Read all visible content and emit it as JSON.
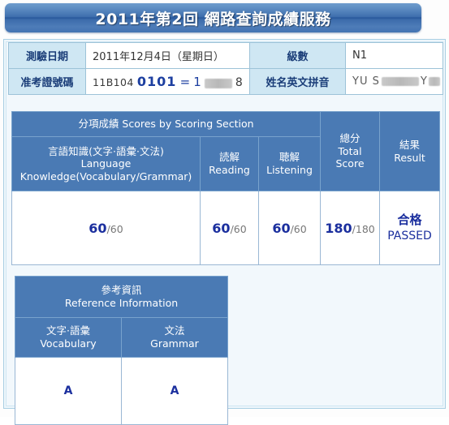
{
  "header": {
    "title": "2011年第2回 網路查詢成績服務"
  },
  "info": {
    "rows": [
      {
        "label": "測驗日期",
        "value": "2011年12月4日（星期日）",
        "label2": "級數",
        "value2": "N1"
      },
      {
        "label": "准考證號碼",
        "code_prefix": "11B104",
        "code_mid": "0101",
        "code_eq": "=",
        "code_after_eq": "1",
        "code_tail": "8",
        "label2": "姓名英文拼音",
        "name_prefix": "YU S",
        "name_mid": "Y"
      }
    ]
  },
  "scores": {
    "section_header": "分項成績 Scores by Scoring Section",
    "columns": [
      {
        "cn": "言語知識(文字·語彙·文法)",
        "en_line1": "Language",
        "en_line2": "Knowledge(Vocabulary/Grammar)",
        "score": "60",
        "max": "/60"
      },
      {
        "cn": "読解",
        "en_line1": "Reading",
        "en_line2": "",
        "score": "60",
        "max": "/60"
      },
      {
        "cn": "聴解",
        "en_line1": "Listening",
        "en_line2": "",
        "score": "60",
        "max": "/60"
      }
    ],
    "total": {
      "cn": "總分",
      "en_line1": "Total",
      "en_line2": "Score",
      "score": "180",
      "max": "/180"
    },
    "result": {
      "cn": "結果",
      "en_line1": "Result",
      "value_cn": "合格",
      "value_en": "PASSED"
    }
  },
  "reference": {
    "title_cn": "參考資訊",
    "title_en": "Reference Information",
    "columns": [
      {
        "cn": "文字·語彙",
        "en": "Vocabulary",
        "grade": "A"
      },
      {
        "cn": "文法",
        "en": "Grammar",
        "grade": "A"
      }
    ]
  },
  "colors": {
    "title_bar_blue": "#27579b",
    "table_header_blue": "#4a7ab4",
    "label_cell_blue": "#cfe7f3",
    "score_navy": "#1b2f9e",
    "panel_bg": "#f2f8fc"
  }
}
